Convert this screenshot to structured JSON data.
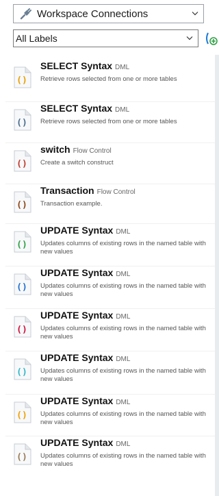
{
  "connections": {
    "label": "Workspace Connections",
    "icon": "plug-icon"
  },
  "labels_filter": {
    "label": "All Labels"
  },
  "snippets": [
    {
      "title": "SELECT Syntax",
      "category": "DML",
      "description": "Retrieve rows selected from one or more tables",
      "icon_color": "#e8a000",
      "icon": "code-brackets-icon"
    },
    {
      "title": "SELECT Syntax",
      "category": "DML",
      "description": "Retrieve rows selected from one or more tables",
      "icon_color": "#4a6d8c",
      "icon": "code-brackets-icon"
    },
    {
      "title": "switch",
      "category": "Flow Control",
      "description": "Create a switch construct",
      "icon_color": "#c0392b",
      "icon": "code-brackets-icon"
    },
    {
      "title": "Transaction",
      "category": "Flow Control",
      "description": "Transaction example.",
      "icon_color": "#8b4513",
      "icon": "code-brackets-icon"
    },
    {
      "title": "UPDATE Syntax",
      "category": "DML",
      "description": "Updates columns of existing rows in the named table with new values",
      "icon_color": "#2ea043",
      "icon": "code-brackets-icon"
    },
    {
      "title": "UPDATE Syntax",
      "category": "DML",
      "description": "Updates columns of existing rows in the named table with new values",
      "icon_color": "#1f6fd1",
      "icon": "code-brackets-icon"
    },
    {
      "title": "UPDATE Syntax",
      "category": "DML",
      "description": "Updates columns of existing rows in the named table with new values",
      "icon_color": "#d0103a",
      "icon": "code-brackets-icon"
    },
    {
      "title": "UPDATE Syntax",
      "category": "DML",
      "description": "Updates columns of existing rows in the named table with new values",
      "icon_color": "#31b7c9",
      "icon": "code-brackets-icon"
    },
    {
      "title": "UPDATE Syntax",
      "category": "DML",
      "description": "Updates columns of existing rows in the named table with new values",
      "icon_color": "#f0a000",
      "icon": "code-brackets-icon"
    },
    {
      "title": "UPDATE Syntax",
      "category": "DML",
      "description": "Updates columns of existing rows in the named table with new values",
      "icon_color": "#9a7a55",
      "icon": "code-brackets-icon"
    }
  ]
}
